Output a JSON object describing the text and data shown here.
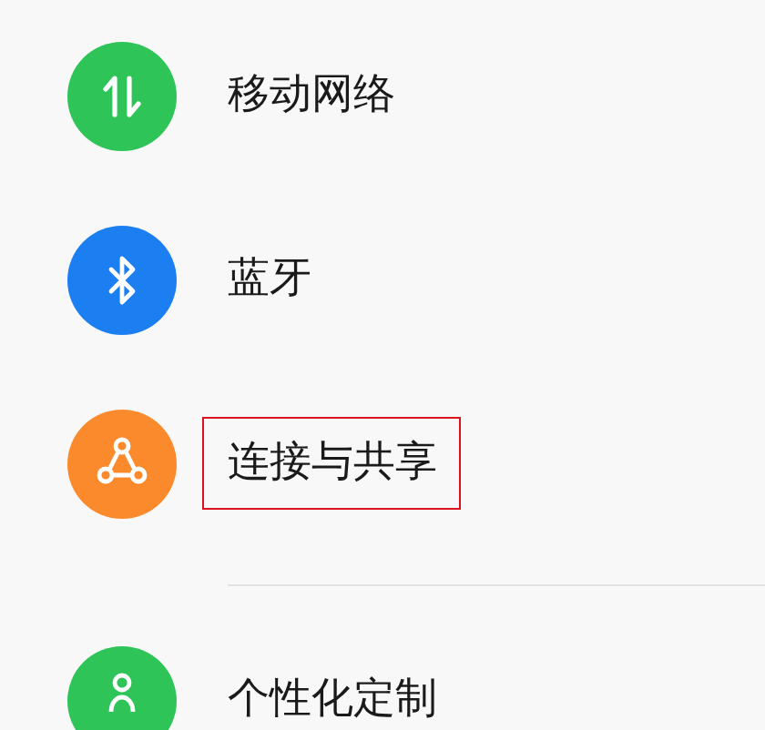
{
  "sections": [
    {
      "items": [
        {
          "label": "移动网络",
          "kind": "arrows",
          "color": "#2ec458",
          "highlighted": false
        },
        {
          "label": "蓝牙",
          "kind": "bluetooth",
          "color": "#1b7ff2",
          "highlighted": false
        },
        {
          "label": "连接与共享",
          "kind": "share",
          "color": "#fb8a2d",
          "highlighted": true
        }
      ]
    },
    {
      "items": [
        {
          "label": "个性化定制",
          "kind": "person",
          "color": "#2ec458",
          "highlighted": false
        }
      ]
    }
  ]
}
